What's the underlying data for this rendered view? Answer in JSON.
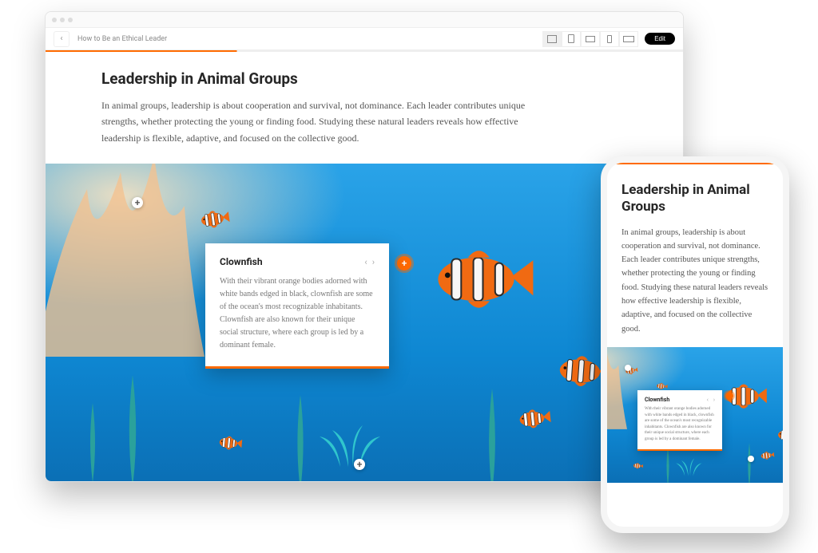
{
  "toolbar": {
    "breadcrumb": "How to Be an Ethical Leader",
    "edit_label": "Edit"
  },
  "article": {
    "heading": "Leadership in Animal Groups",
    "body": "In animal groups, leadership is about cooperation and survival, not dominance. Each leader contributes unique strengths, whether protecting the young or finding food. Studying these natural leaders reveals how effective leadership is flexible, adaptive, and focused on the collective good."
  },
  "popup": {
    "title": "Clownfish",
    "body": "With their vibrant orange bodies adorned with white bands edged in black, clownfish are some of the ocean's most recognizable inhabitants. Clownfish are also known for their unique social structure, where each group is led by a dominant female."
  },
  "colors": {
    "accent": "#ff6a00"
  }
}
